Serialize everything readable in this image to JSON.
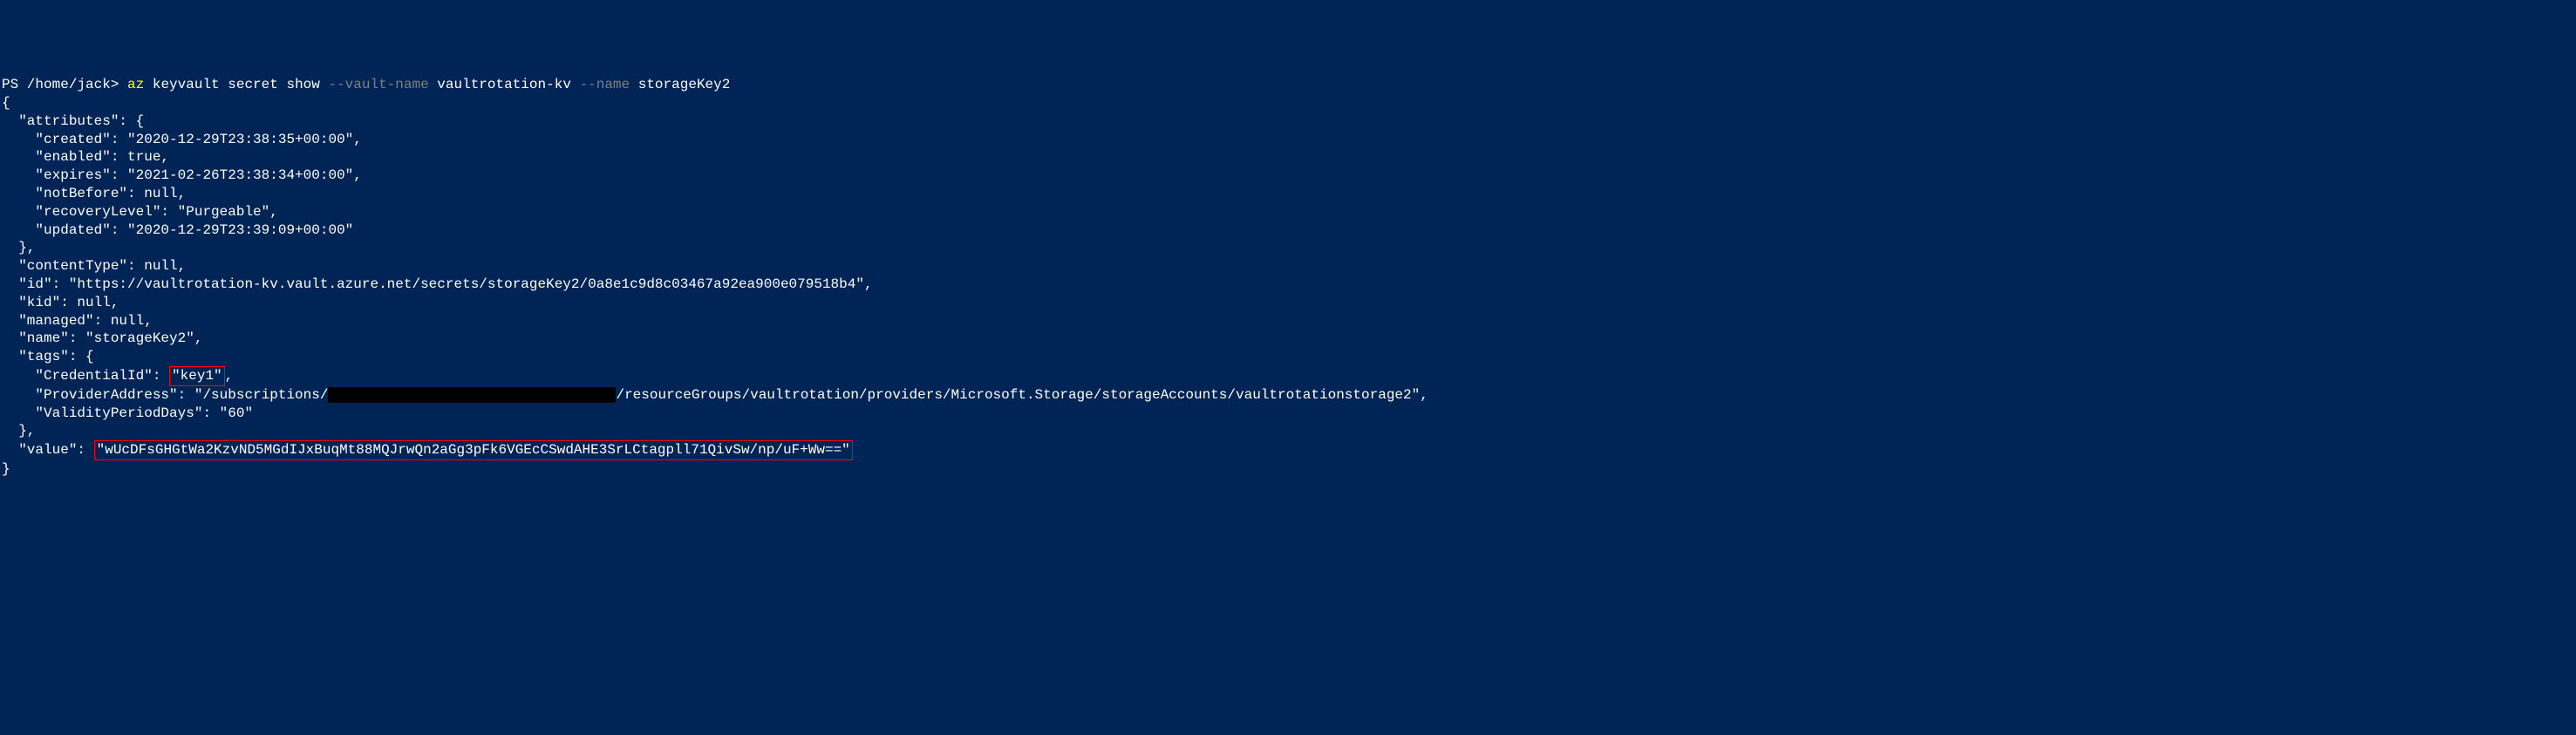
{
  "prompt": {
    "prefix": "PS /home/jack> ",
    "cmd_az": "az",
    "cmd_args1": " keyvault secret show ",
    "param_vault": "--vault-name",
    "val_vault": " vaultrotation-kv ",
    "param_name": "--name",
    "val_name": " storageKey2"
  },
  "json_output": {
    "open_brace": "{",
    "attributes_label": "  \"attributes\": {",
    "created": "    \"created\": \"2020-12-29T23:38:35+00:00\",",
    "enabled": "    \"enabled\": true,",
    "expires": "    \"expires\": \"2021-02-26T23:38:34+00:00\",",
    "notBefore": "    \"notBefore\": null,",
    "recoveryLevel": "    \"recoveryLevel\": \"Purgeable\",",
    "updated": "    \"updated\": \"2020-12-29T23:39:09+00:00\"",
    "attributes_close": "  },",
    "contentType": "  \"contentType\": null,",
    "id": "  \"id\": \"https://vaultrotation-kv.vault.azure.net/secrets/storageKey2/0a8e1c9d8c03467a92ea900e079518b4\",",
    "kid": "  \"kid\": null,",
    "managed": "  \"managed\": null,",
    "name": "  \"name\": \"storageKey2\",",
    "tags_label": "  \"tags\": {",
    "credentialId_prefix": "    \"CredentialId\": ",
    "credentialId_value": "\"key1\"",
    "credentialId_suffix": ",",
    "providerAddress_prefix": "    \"ProviderAddress\": \"/subscriptions/",
    "providerAddress_suffix": "/resourceGroups/vaultrotation/providers/Microsoft.Storage/storageAccounts/vaultrotationstorage2\",",
    "validityPeriodDays": "    \"ValidityPeriodDays\": \"60\"",
    "tags_close": "  },",
    "value_prefix": "  \"value\": ",
    "value_box": "\"wUcDFsGHGtWa2KzvND5MGdIJxBuqMt88MQJrwQn2aGg3pFk6VGEcCSwdAHE3SrLCtagpll71QivSw/np/uF+Ww==\"",
    "close_brace": "}"
  }
}
